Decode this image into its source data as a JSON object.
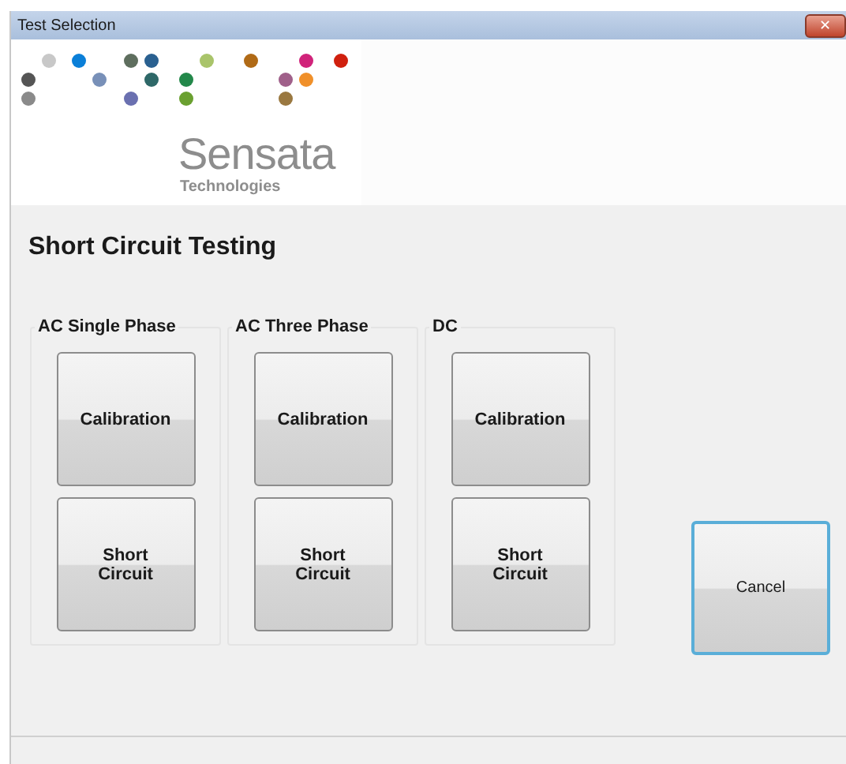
{
  "window": {
    "title": "Test Selection",
    "close": "✕"
  },
  "logo": {
    "name": "Sensata",
    "subtitle": "Technologies"
  },
  "heading": "Short Circuit Testing",
  "groups": [
    {
      "title": "AC Single Phase",
      "buttons": [
        "Calibration",
        "Short Circuit"
      ]
    },
    {
      "title": "AC Three Phase",
      "buttons": [
        "Calibration",
        "Short Circuit"
      ]
    },
    {
      "title": "DC",
      "buttons": [
        "Calibration",
        "Short Circuit"
      ]
    }
  ],
  "cancel": {
    "label": "Cancel",
    "focused": true
  }
}
